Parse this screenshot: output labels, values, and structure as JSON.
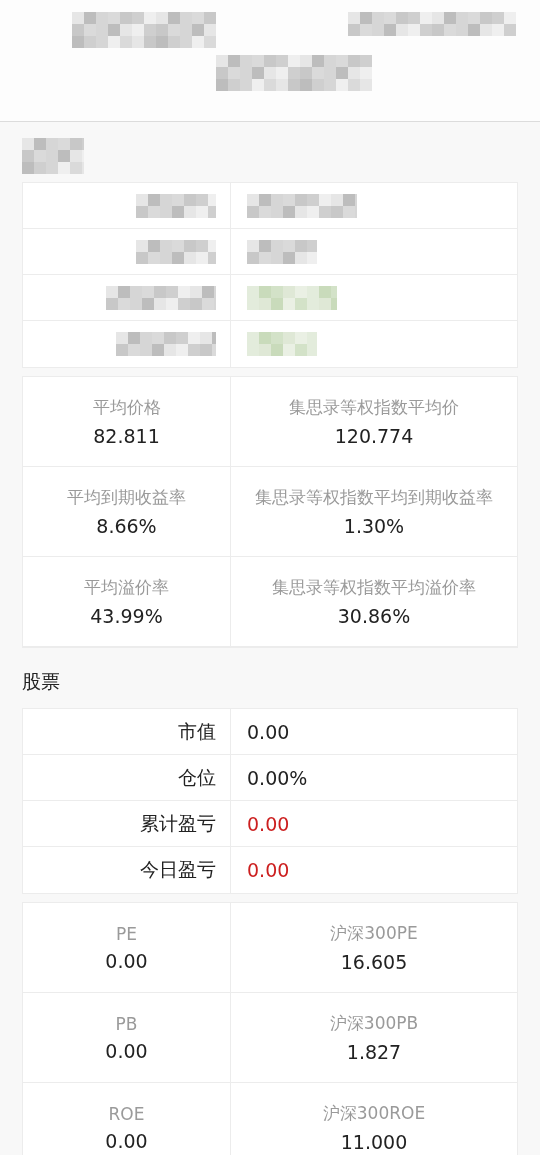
{
  "bond_summary": [
    {
      "label": "平均价格",
      "value": "82.811"
    },
    {
      "label": "集思录等权指数平均价",
      "value": "120.774"
    },
    {
      "label": "平均到期收益率",
      "value": "8.66%"
    },
    {
      "label": "集思录等权指数平均到期收益率",
      "value": "1.30%"
    },
    {
      "label": "平均溢价率",
      "value": "43.99%"
    },
    {
      "label": "集思录等权指数平均溢价率",
      "value": "30.86%"
    }
  ],
  "stock_section": {
    "title": "股票",
    "rows": [
      {
        "label": "市值",
        "value": "0.00",
        "color": "#222222"
      },
      {
        "label": "仓位",
        "value": "0.00%",
        "color": "#222222"
      },
      {
        "label": "累计盈亏",
        "value": "0.00",
        "color": "#cc1f1f"
      },
      {
        "label": "今日盈亏",
        "value": "0.00",
        "color": "#cc1f1f"
      }
    ],
    "metrics": [
      {
        "label": "PE",
        "value": "0.00"
      },
      {
        "label": "沪深300PE",
        "value": "16.605"
      },
      {
        "label": "PB",
        "value": "0.00"
      },
      {
        "label": "沪深300PB",
        "value": "1.827"
      },
      {
        "label": "ROE",
        "value": "0.00"
      },
      {
        "label": "沪深300ROE",
        "value": "11.000"
      }
    ]
  }
}
